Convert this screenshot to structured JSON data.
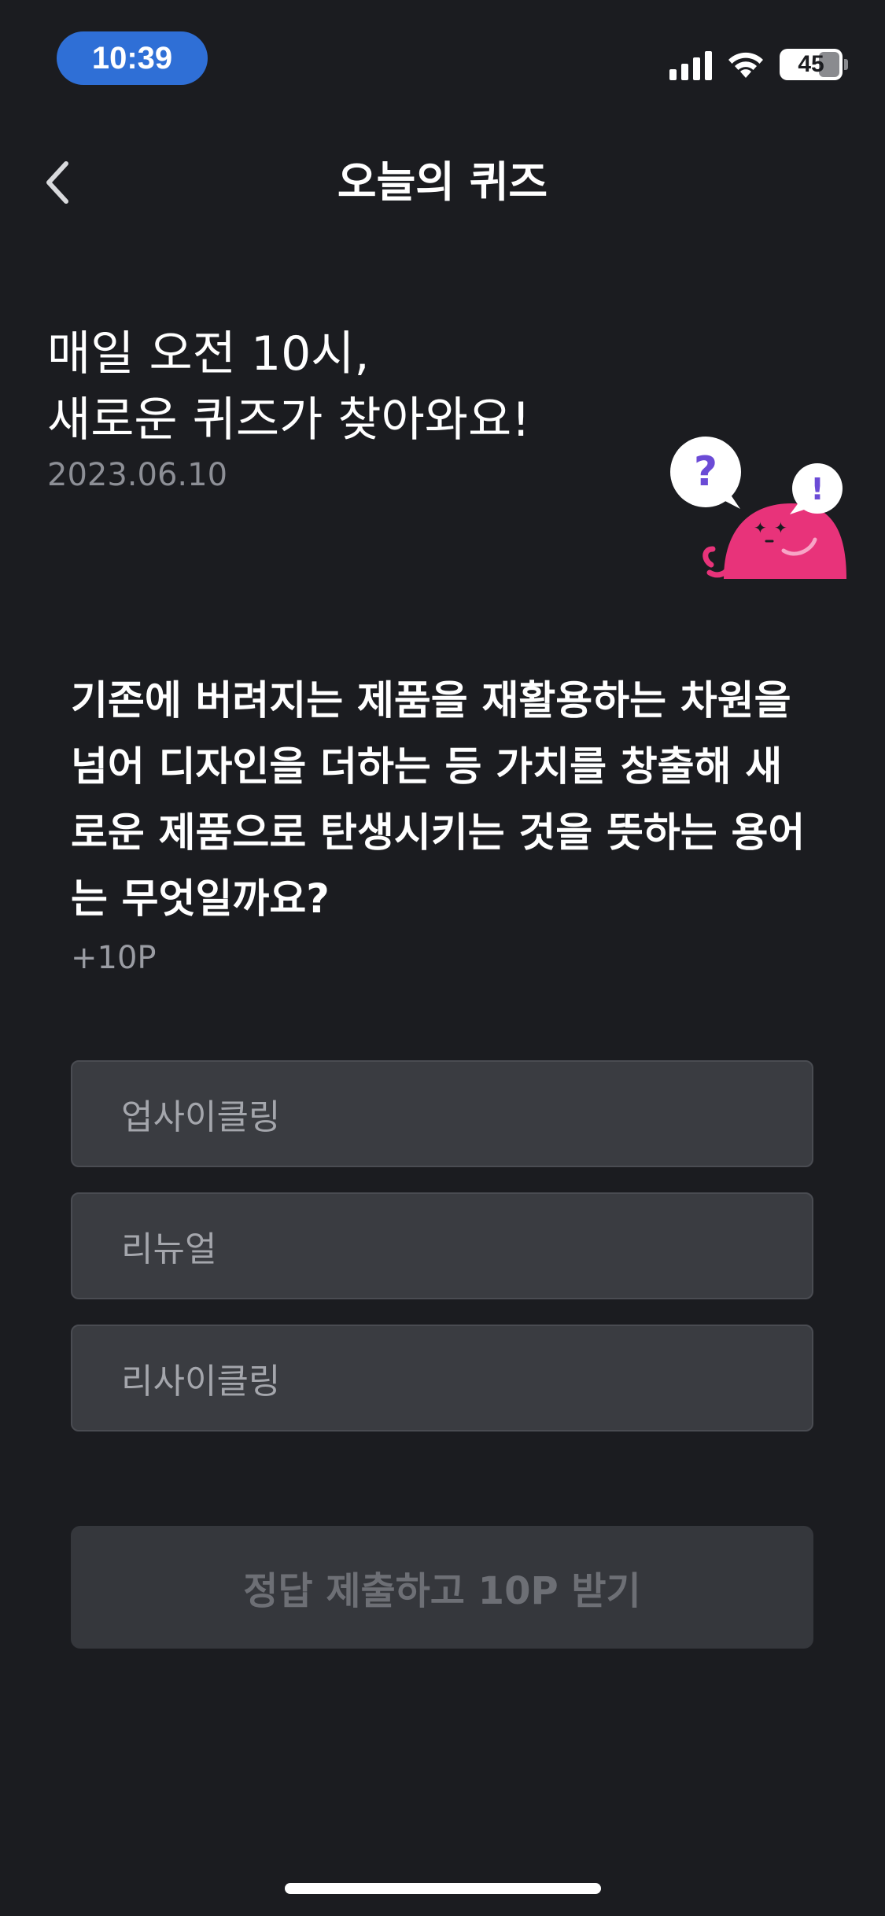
{
  "status_bar": {
    "time": "10:39",
    "battery": "45",
    "signal_icon": "cellular-signal-icon",
    "wifi_icon": "wifi-icon",
    "battery_icon": "battery-icon"
  },
  "header": {
    "back_icon": "chevron-left-icon",
    "title": "오늘의 퀴즈"
  },
  "intro": {
    "line1": "매일 오전 10시,",
    "line2": "새로운 퀴즈가 찾아와요!",
    "date": "2023.06.10",
    "mascot_icon": "quiz-mascot-icon",
    "bubble_question": "?",
    "bubble_exclaim": "!"
  },
  "question": {
    "lines": [
      "기존에 버려지는 제품을 재활용하는 차원을",
      "넘어 디자인을 더하는 등 가치를 창출해 새",
      "로운 제품으로 탄생시키는 것을 뜻하는 용어",
      "는 무엇일까요?"
    ],
    "points": "+10P"
  },
  "options": [
    {
      "label": "업사이클링"
    },
    {
      "label": "리뉴얼"
    },
    {
      "label": "리사이클링"
    }
  ],
  "submit": {
    "label": "정답 제출하고 10P 받기"
  },
  "colors": {
    "background": "#1b1c20",
    "time_pill": "#2f6fd6",
    "mascot": "#e8337a",
    "option_bg": "#3a3c41",
    "submit_bg": "#35373c"
  }
}
